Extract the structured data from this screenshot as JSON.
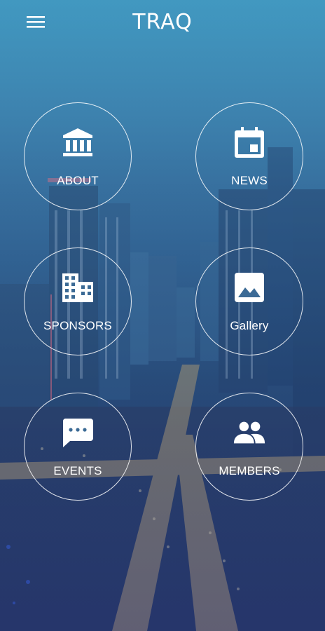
{
  "header": {
    "title": "TRAQ",
    "menu_icon": "hamburger-menu-icon"
  },
  "tiles": [
    {
      "label": "ABOUT",
      "icon": "bank-building-icon"
    },
    {
      "label": "NEWS",
      "icon": "calendar-event-icon"
    },
    {
      "label": "SPONSORS",
      "icon": "office-building-icon"
    },
    {
      "label": "Gallery",
      "icon": "image-icon"
    },
    {
      "label": "EVENTS",
      "icon": "chat-message-icon"
    },
    {
      "label": "MEMBERS",
      "icon": "people-group-icon"
    }
  ],
  "colors": {
    "top": "#3c8fb7",
    "bottom": "#1f2f52",
    "ring": "#ffffff"
  }
}
